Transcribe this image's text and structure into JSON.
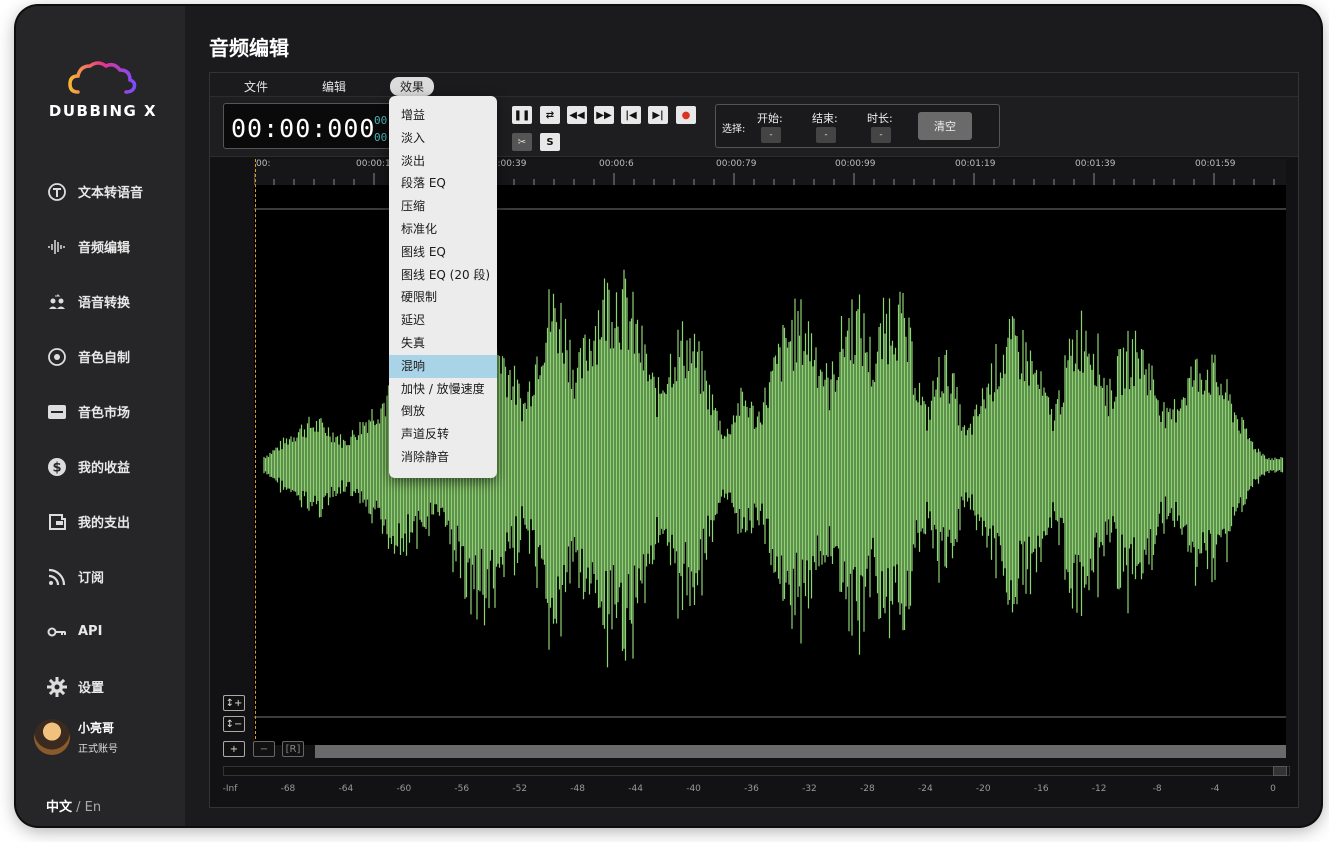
{
  "page": {
    "title": "音频编辑"
  },
  "brand": {
    "logo_text": "DUBBING X"
  },
  "sidebar": {
    "items": [
      {
        "label": "文本转语音",
        "icon": "text-to-speech-icon"
      },
      {
        "label": "音频编辑",
        "icon": "waveform-icon"
      },
      {
        "label": "语音转换",
        "icon": "voice-convert-icon"
      },
      {
        "label": "音色自制",
        "icon": "voice-custom-icon"
      },
      {
        "label": "音色市场",
        "icon": "store-icon"
      },
      {
        "label": "我的收益",
        "icon": "dollar-icon"
      },
      {
        "label": "我的支出",
        "icon": "wallet-icon"
      },
      {
        "label": "订阅",
        "icon": "rss-icon"
      },
      {
        "label": "API",
        "icon": "key-icon"
      },
      {
        "label": "设置",
        "icon": "gear-icon"
      }
    ],
    "user": {
      "name": "小亮哥",
      "account": "正式账号"
    },
    "lang": {
      "current": "中文",
      "sep": " / ",
      "other": "En"
    }
  },
  "editor": {
    "menu": {
      "file": "文件",
      "edit": "编辑",
      "effects": "效果"
    },
    "time": {
      "main": "00:00:000",
      "small1": "00",
      "small2": "00"
    },
    "selection": {
      "label": "选择:",
      "start": "开始:",
      "end": "结束:",
      "duration": "时长:",
      "start_value": "-",
      "end_value": "-",
      "duration_value": "-",
      "clear": "清空"
    },
    "buttons": {
      "scissors": "✂",
      "s": "S"
    },
    "ruler": [
      "00:",
      "00:00:1",
      "00:00:39",
      "00:00:6",
      "00:00:79",
      "00:00:99",
      "00:01:19",
      "00:01:39",
      "00:01:59"
    ],
    "zoom": {
      "v_in": "↕+",
      "v_out": "↕−",
      "h_in": "+",
      "h_out": "−",
      "reset": "[R]"
    },
    "meter": [
      "-Inf",
      "-68",
      "-64",
      "-60",
      "-56",
      "-52",
      "-48",
      "-44",
      "-40",
      "-36",
      "-32",
      "-28",
      "-24",
      "-20",
      "-16",
      "-12",
      "-8",
      "-4",
      "0"
    ],
    "waveform_color": "#8ed373"
  },
  "effects_menu": {
    "items": [
      "增益",
      "淡入",
      "淡出",
      "段落 EQ",
      "压缩",
      "标准化",
      "图线 EQ",
      "图线 EQ (20 段)",
      "硬限制",
      "延迟",
      "失真",
      "混响",
      "加快 / 放慢速度",
      "倒放",
      "声道反转",
      "消除静音"
    ],
    "highlighted": "混响"
  }
}
